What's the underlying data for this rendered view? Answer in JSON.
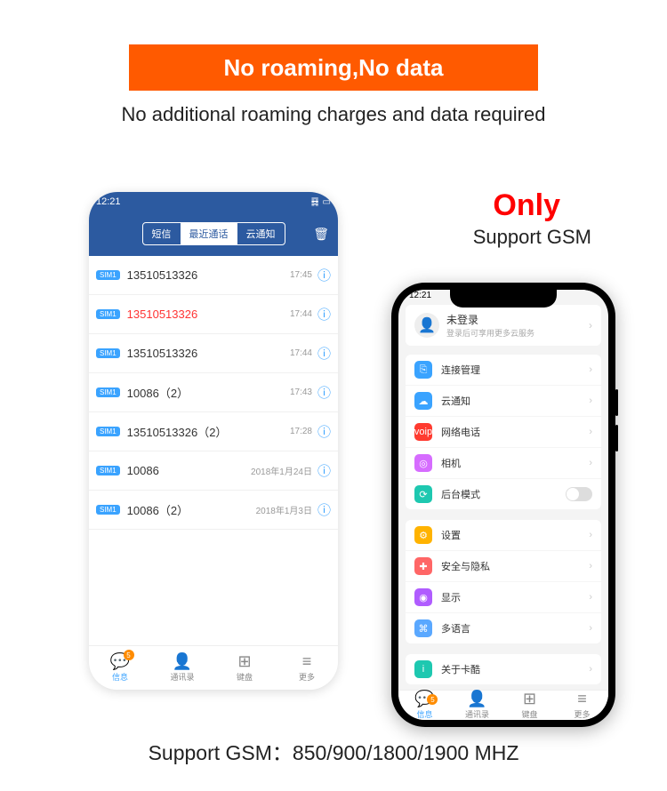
{
  "banner": "No roaming,No data",
  "subtitle": "No additional roaming charges and data required",
  "only_text": "Only",
  "support_gsm_top": "Support GSM",
  "footer": "Support GSM：850/900/1800/1900 MHZ",
  "left_phone": {
    "status_time": "12:21",
    "tabs": {
      "sms": "短信",
      "recent": "最近通话",
      "cloud": "云通知"
    },
    "calls": [
      {
        "sim": "SIM1",
        "number": "13510513326",
        "time": "17:45",
        "missed": false
      },
      {
        "sim": "SIM1",
        "number": "13510513326",
        "time": "17:44",
        "missed": true
      },
      {
        "sim": "SIM1",
        "number": "13510513326",
        "time": "17:44",
        "missed": false
      },
      {
        "sim": "SIM1",
        "number": "10086（2）",
        "time": "17:43",
        "missed": false
      },
      {
        "sim": "SIM1",
        "number": "13510513326（2）",
        "time": "17:28",
        "missed": false
      },
      {
        "sim": "SIM1",
        "number": "10086",
        "time": "2018年1月24日",
        "missed": false
      },
      {
        "sim": "SIM1",
        "number": "10086（2）",
        "time": "2018年1月3日",
        "missed": false
      }
    ],
    "tabbar": {
      "msg": "信息",
      "contacts": "通讯录",
      "dial": "键盘",
      "more": "更多",
      "badge": "5"
    }
  },
  "right_phone": {
    "status_time": "12:21",
    "profile": {
      "title": "未登录",
      "sub": "登录后可享用更多云服务"
    },
    "group1": [
      {
        "label": "连接管理",
        "color": "#3aa3ff",
        "icon": "⎘"
      },
      {
        "label": "云通知",
        "color": "#3aa3ff",
        "icon": "☁"
      },
      {
        "label": "网络电话",
        "color": "#ff3b30",
        "icon": "voip"
      },
      {
        "label": "相机",
        "color": "#d66cff",
        "icon": "◎"
      },
      {
        "label": "后台模式",
        "color": "#1ec8b0",
        "icon": "⟳",
        "toggle": true
      }
    ],
    "group2": [
      {
        "label": "设置",
        "color": "#ffb300",
        "icon": "⚙"
      },
      {
        "label": "安全与隐私",
        "color": "#ff6666",
        "icon": "✚"
      },
      {
        "label": "显示",
        "color": "#b05cff",
        "icon": "◉"
      },
      {
        "label": "多语言",
        "color": "#5aa8ff",
        "icon": "⌘"
      }
    ],
    "group3": [
      {
        "label": "关于卡酷",
        "color": "#1ec8b0",
        "icon": "i"
      }
    ],
    "tabbar": {
      "msg": "信息",
      "contacts": "通讯录",
      "dial": "键盘",
      "more": "更多",
      "badge": "5"
    }
  }
}
